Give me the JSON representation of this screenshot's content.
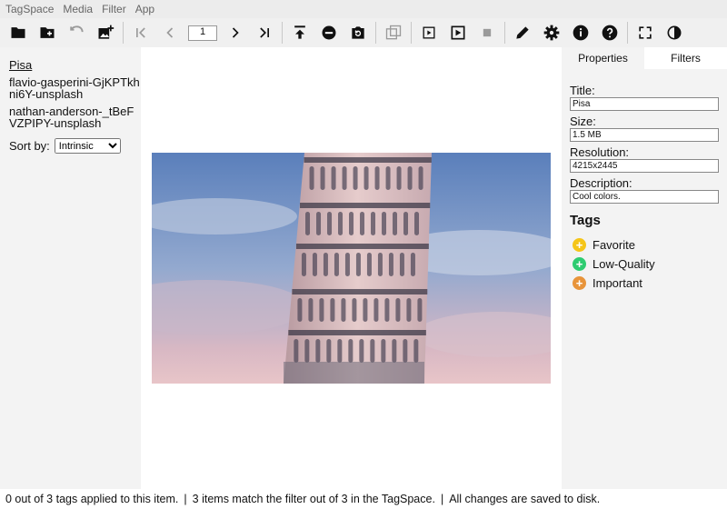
{
  "menu": [
    "TagSpace",
    "Media",
    "Filter",
    "App"
  ],
  "toolbar": {
    "icons": [
      "folder-open-icon",
      "add-folder-icon",
      "undo-icon",
      "add-image-icon",
      "first-page-icon",
      "previous-page-icon",
      "next-page-icon",
      "last-page-icon",
      "move-to-top-icon",
      "remove-icon",
      "reload-icon",
      "copy-icon",
      "play-icon",
      "play-all-icon",
      "stop-icon",
      "edit-icon",
      "settings-icon",
      "info-icon",
      "help-icon",
      "fullscreen-icon",
      "contrast-icon"
    ],
    "page_number": "1"
  },
  "files": [
    {
      "name": "Pisa",
      "active": true
    },
    {
      "name": "flavio-gasperini-GjKPTkhni6Y-unsplash",
      "active": false
    },
    {
      "name": "nathan-anderson-_tBeFVZPIPY-unsplash",
      "active": false
    }
  ],
  "sort": {
    "label": "Sort by:",
    "selected": "Intrinsic"
  },
  "panel": {
    "tabs": [
      "Properties",
      "Filters"
    ],
    "active_tab": "Properties",
    "fields": {
      "title_label": "Title:",
      "title_value": "Pisa",
      "size_label": "Size:",
      "size_value": "1.5 MB",
      "resolution_label": "Resolution:",
      "resolution_value": "4215x2445",
      "description_label": "Description:",
      "description_value": "Cool colors."
    },
    "tags_heading": "Tags",
    "tags": [
      {
        "name": "Favorite",
        "color": "#f5c518",
        "symbol": "+"
      },
      {
        "name": "Low-Quality",
        "color": "#2ecc71",
        "symbol": "+"
      },
      {
        "name": "Important",
        "color": "#e8943a",
        "symbol": "+"
      }
    ]
  },
  "status": {
    "tags_applied": "0 out of 3 tags applied to this item.",
    "filter_match": "3 items match the filter out of 3 in the TagSpace.",
    "saved": "All changes are saved to disk.",
    "separator": "|"
  },
  "colors": {
    "toolbar_bg": "#f0f0f0",
    "sidebar_bg": "#f3f3f3",
    "icon": "#111111",
    "icon_disabled": "#9a9a9a"
  }
}
